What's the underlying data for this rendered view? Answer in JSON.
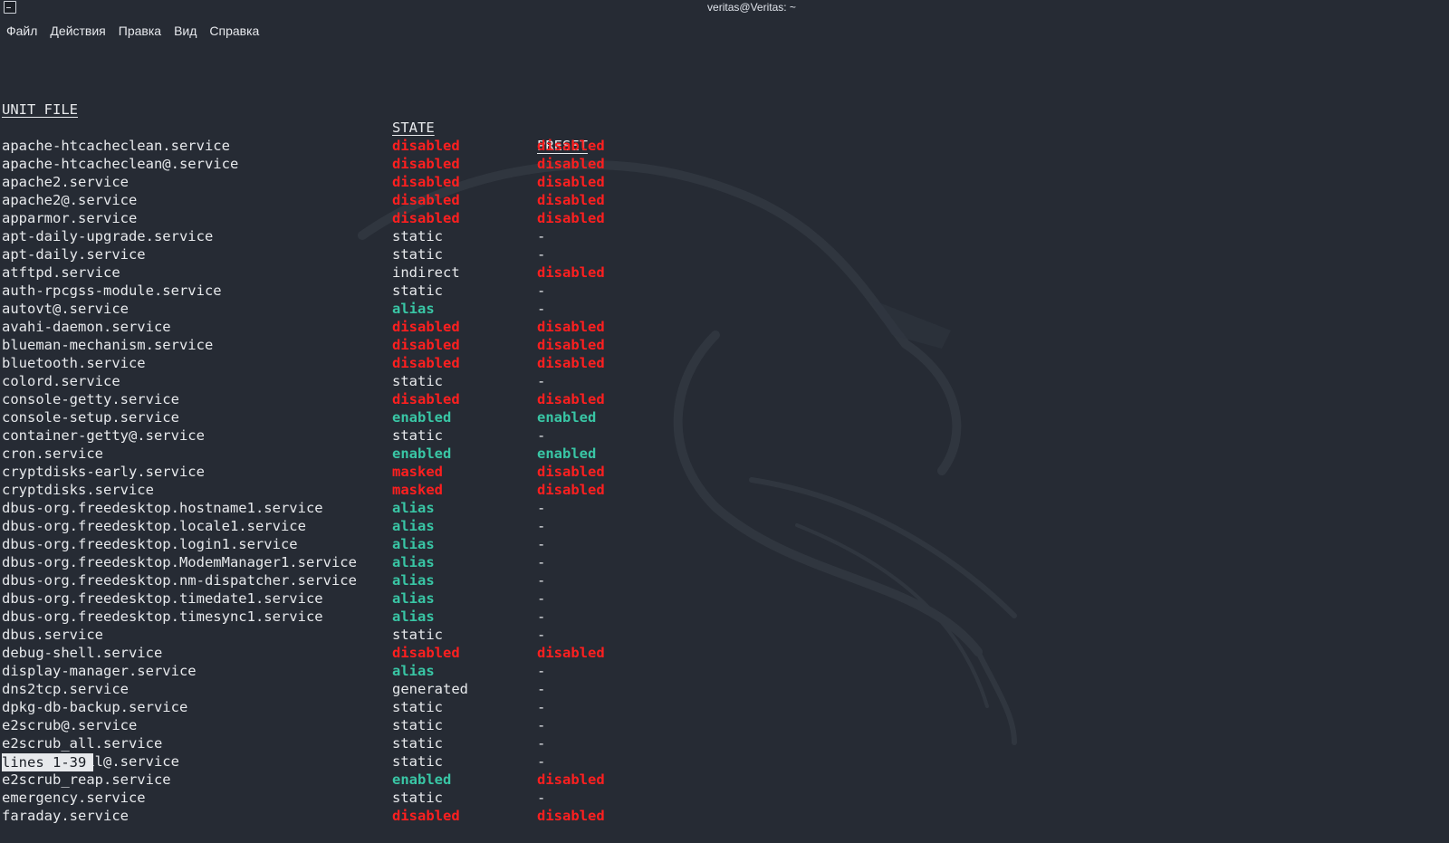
{
  "window": {
    "title": "veritas@Veritas: ~",
    "icon": "terminal-icon"
  },
  "menu": [
    "Файл",
    "Действия",
    "Правка",
    "Вид",
    "Справка"
  ],
  "colors": {
    "background": "#262b34",
    "text": "#e7e9ec",
    "red": "#ff1f1f",
    "green": "#39c6a5"
  },
  "table": {
    "headers": [
      "UNIT FILE",
      "STATE",
      "PRESET"
    ],
    "rows": [
      [
        "apache-htcacheclean.service",
        "disabled",
        "disabled"
      ],
      [
        "apache-htcacheclean@.service",
        "disabled",
        "disabled"
      ],
      [
        "apache2.service",
        "disabled",
        "disabled"
      ],
      [
        "apache2@.service",
        "disabled",
        "disabled"
      ],
      [
        "apparmor.service",
        "disabled",
        "disabled"
      ],
      [
        "apt-daily-upgrade.service",
        "static",
        "-"
      ],
      [
        "apt-daily.service",
        "static",
        "-"
      ],
      [
        "atftpd.service",
        "indirect",
        "disabled"
      ],
      [
        "auth-rpcgss-module.service",
        "static",
        "-"
      ],
      [
        "autovt@.service",
        "alias",
        "-"
      ],
      [
        "avahi-daemon.service",
        "disabled",
        "disabled"
      ],
      [
        "blueman-mechanism.service",
        "disabled",
        "disabled"
      ],
      [
        "bluetooth.service",
        "disabled",
        "disabled"
      ],
      [
        "colord.service",
        "static",
        "-"
      ],
      [
        "console-getty.service",
        "disabled",
        "disabled"
      ],
      [
        "console-setup.service",
        "enabled",
        "enabled"
      ],
      [
        "container-getty@.service",
        "static",
        "-"
      ],
      [
        "cron.service",
        "enabled",
        "enabled"
      ],
      [
        "cryptdisks-early.service",
        "masked",
        "disabled"
      ],
      [
        "cryptdisks.service",
        "masked",
        "disabled"
      ],
      [
        "dbus-org.freedesktop.hostname1.service",
        "alias",
        "-"
      ],
      [
        "dbus-org.freedesktop.locale1.service",
        "alias",
        "-"
      ],
      [
        "dbus-org.freedesktop.login1.service",
        "alias",
        "-"
      ],
      [
        "dbus-org.freedesktop.ModemManager1.service",
        "alias",
        "-"
      ],
      [
        "dbus-org.freedesktop.nm-dispatcher.service",
        "alias",
        "-"
      ],
      [
        "dbus-org.freedesktop.timedate1.service",
        "alias",
        "-"
      ],
      [
        "dbus-org.freedesktop.timesync1.service",
        "alias",
        "-"
      ],
      [
        "dbus.service",
        "static",
        "-"
      ],
      [
        "debug-shell.service",
        "disabled",
        "disabled"
      ],
      [
        "display-manager.service",
        "alias",
        "-"
      ],
      [
        "dns2tcp.service",
        "generated",
        "-"
      ],
      [
        "dpkg-db-backup.service",
        "static",
        "-"
      ],
      [
        "e2scrub@.service",
        "static",
        "-"
      ],
      [
        "e2scrub_all.service",
        "static",
        "-"
      ],
      [
        "e2scrub_fail@.service",
        "static",
        "-"
      ],
      [
        "e2scrub_reap.service",
        "enabled",
        "disabled"
      ],
      [
        "emergency.service",
        "static",
        "-"
      ],
      [
        "faraday.service",
        "disabled",
        "disabled"
      ]
    ]
  },
  "status_line": "lines 1-39"
}
